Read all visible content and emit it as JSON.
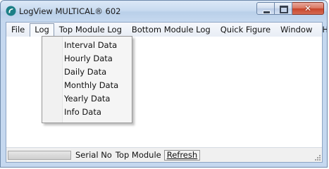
{
  "window": {
    "title": "LogView MULTICAL® 602",
    "close_glyph": "✕"
  },
  "menubar": {
    "items": [
      "File",
      "Log",
      "Top Module Log",
      "Bottom Module Log",
      "Quick Figure",
      "Window",
      "Help"
    ],
    "open_menu": "Log"
  },
  "log_menu": {
    "items": [
      "Interval Data",
      "Hourly Data",
      "Daily Data",
      "Monthly Data",
      "Yearly Data",
      "Info Data"
    ]
  },
  "statusbar": {
    "serial_label": "Serial No",
    "module_label": "Top Module",
    "refresh_label": "Refresh"
  },
  "colors": {
    "title_gradient_accent": "#c9dbf0",
    "close_button": "#c8442a",
    "window_frame": "#c5d8ef"
  },
  "icons": {
    "app": "logview-app-icon",
    "minimize": "minimize-icon",
    "maximize": "maximize-icon",
    "close": "close-icon",
    "grip": "resize-grip-icon"
  }
}
